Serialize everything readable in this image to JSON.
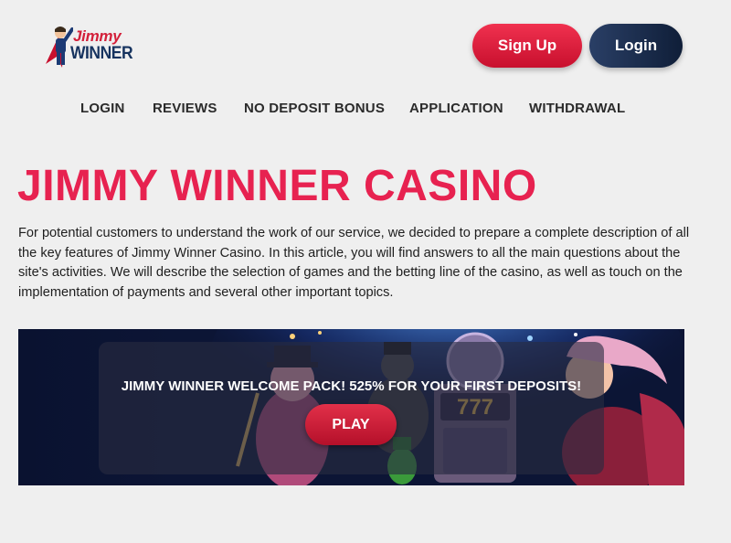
{
  "header": {
    "logo": {
      "line1": "Jimmy",
      "line2": "WINNER"
    },
    "signup_label": "Sign Up",
    "login_label": "Login"
  },
  "nav": {
    "items": [
      {
        "label": "LOGIN"
      },
      {
        "label": "REVIEWS"
      },
      {
        "label": "NO DEPOSIT BONUS"
      },
      {
        "label": "APPLICATION"
      },
      {
        "label": "WITHDRAWAL"
      }
    ]
  },
  "main": {
    "title": "JIMMY WINNER CASINO",
    "intro": "For potential customers to understand the work of our service, we decided to prepare a complete description of all the key features of Jimmy Winner Casino. In this article, you will find answers to all the main questions about the site's activities. We will describe the selection of games and the betting line of the casino, as well as touch on the implementation of payments and several other important topics."
  },
  "banner": {
    "text": "JIMMY WINNER WELCOME PACK! 525% FOR YOUR FIRST DEPOSITS!",
    "play_label": "PLAY",
    "slot_reels": "777"
  },
  "colors": {
    "accent": "#e72250",
    "signup": "#d81f3c",
    "login": "#16284a",
    "banner_bg": "#0c1535"
  }
}
